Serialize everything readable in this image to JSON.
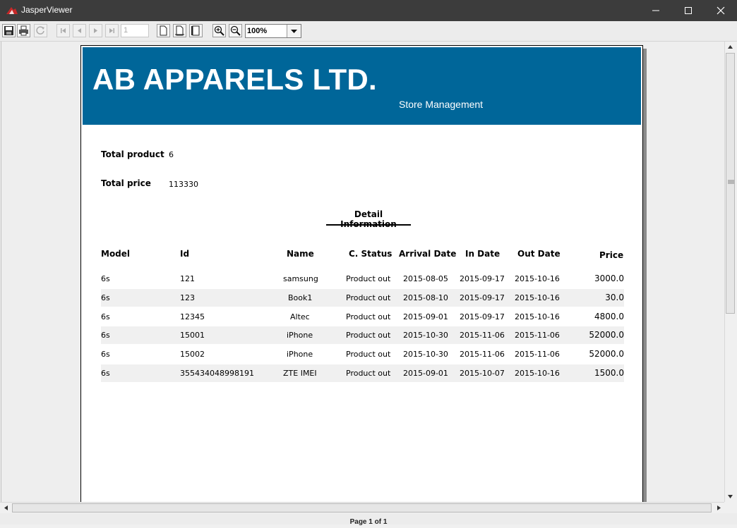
{
  "window": {
    "title": "JasperViewer"
  },
  "toolbar": {
    "page_input": "1",
    "zoom": "100%"
  },
  "report": {
    "company": "AB APPARELS LTD.",
    "subtitle": "Store Management",
    "total_product_label": "Total product",
    "total_product_value": "6",
    "total_price_label": "Total price",
    "total_price_value": "113330",
    "section_title": "Detail Information",
    "columns": [
      "Model",
      "Id",
      "Name",
      "C. Status",
      "Arrival Date",
      "In Date",
      "Out Date",
      "Price"
    ],
    "rows": [
      [
        "6s",
        "121",
        "samsung",
        "Product out",
        "2015-08-05",
        "2015-09-17",
        "2015-10-16",
        "3000.0"
      ],
      [
        "6s",
        "123",
        "Book1",
        "Product out",
        "2015-08-10",
        "2015-09-17",
        "2015-10-16",
        "30.0"
      ],
      [
        "6s",
        "12345",
        "Altec",
        "Product out",
        "2015-09-01",
        "2015-09-17",
        "2015-10-16",
        "4800.0"
      ],
      [
        "6s",
        "15001",
        "iPhone",
        "Product out",
        "2015-10-30",
        "2015-11-06",
        "2015-11-06",
        "52000.0"
      ],
      [
        "6s",
        "15002",
        "iPhone",
        "Product out",
        "2015-10-30",
        "2015-11-06",
        "2015-11-06",
        "52000.0"
      ],
      [
        "6s",
        "355434048998191",
        "ZTE IMEI",
        "Product out",
        "2015-09-01",
        "2015-10-07",
        "2015-10-16",
        "1500.0"
      ]
    ]
  },
  "status": {
    "page_label": "Page 1 of 1"
  },
  "colors": {
    "banner": "#006699",
    "titlebar": "#3c3c3c",
    "alt_row": "#f0f0f0"
  }
}
